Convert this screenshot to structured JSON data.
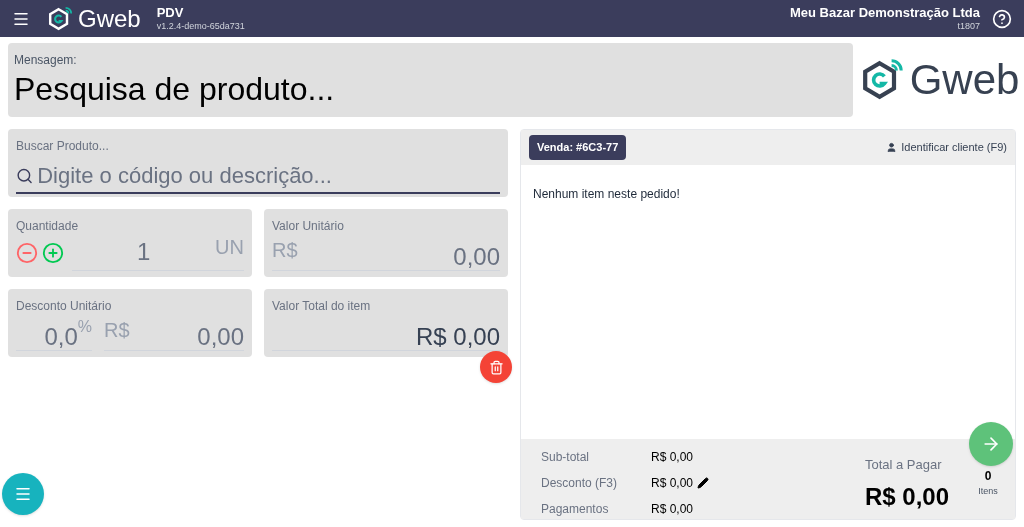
{
  "header": {
    "title": "PDV",
    "version": "v1.2.4-demo-65da731",
    "company": "Meu Bazar Demonstração Ltda",
    "terminal": "t1807",
    "logo_text": "Gweb"
  },
  "message": {
    "label": "Mensagem:",
    "text": "Pesquisa de produto..."
  },
  "brand_logo_text": "Gweb",
  "search": {
    "label": "Buscar Produto...",
    "placeholder": "Digite o código ou descrição..."
  },
  "quantity": {
    "label": "Quantidade",
    "value": "1",
    "unit": "UN"
  },
  "unit_price": {
    "label": "Valor Unitário",
    "currency": "R$",
    "value": "0,00"
  },
  "discount": {
    "label": "Desconto Unitário",
    "percent": "0,0",
    "percent_sign": "%",
    "currency": "R$",
    "value": "0,00"
  },
  "item_total": {
    "label": "Valor Total do item",
    "value": "R$ 0,00"
  },
  "order": {
    "badge": "Venda: #6C3-77",
    "identify": "Identificar cliente (F9)",
    "empty": "Nenhum item neste pedido!",
    "summary": [
      {
        "label": "Sub-total",
        "value": "R$ 0,00",
        "editable": false
      },
      {
        "label": "Desconto (F3)",
        "value": "R$ 0,00",
        "editable": true
      },
      {
        "label": "Pagamentos",
        "value": "R$ 0,00",
        "editable": false
      }
    ],
    "total_label": "Total a Pagar",
    "total": "R$ 0,00",
    "items_count": "0",
    "items_label": "Itens"
  }
}
